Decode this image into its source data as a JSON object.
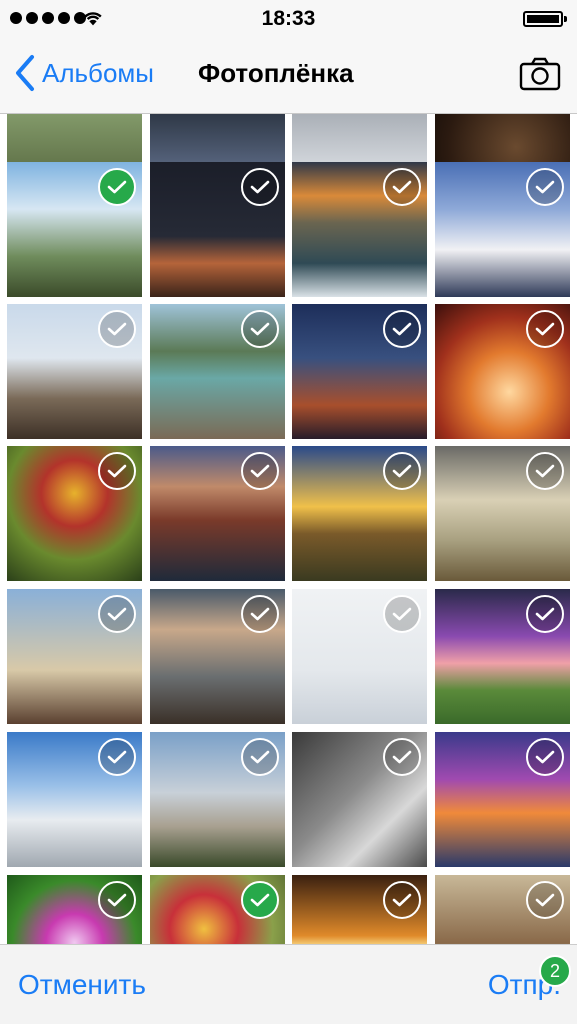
{
  "status": {
    "time": "18:33"
  },
  "nav": {
    "back_label": "Альбомы",
    "title": "Фотоплёнка"
  },
  "toolbar": {
    "cancel_label": "Отменить",
    "send_label": "Отпр.",
    "selected_count": "2"
  },
  "photos": [
    {
      "name": "photo-hills",
      "selected": null
    },
    {
      "name": "photo-lightning",
      "selected": null
    },
    {
      "name": "photo-clouds",
      "selected": null
    },
    {
      "name": "photo-rock",
      "selected": null
    },
    {
      "name": "photo-ibex-mountains",
      "selected": true
    },
    {
      "name": "photo-night-rock",
      "selected": false
    },
    {
      "name": "photo-sea-cliffs",
      "selected": false
    },
    {
      "name": "photo-santorini",
      "selected": false
    },
    {
      "name": "photo-lake-driftwood",
      "selected": false
    },
    {
      "name": "photo-forest-lake",
      "selected": false
    },
    {
      "name": "photo-tokyo-tower",
      "selected": false
    },
    {
      "name": "photo-antelope-canyon",
      "selected": false
    },
    {
      "name": "photo-tulips",
      "selected": false
    },
    {
      "name": "photo-cinque-terre",
      "selected": false
    },
    {
      "name": "photo-sunset-fence",
      "selected": false
    },
    {
      "name": "photo-savanna",
      "selected": false
    },
    {
      "name": "photo-eiffel-tower",
      "selected": false
    },
    {
      "name": "photo-pier",
      "selected": false
    },
    {
      "name": "photo-snow-tree",
      "selected": false
    },
    {
      "name": "photo-purple-hill",
      "selected": false
    },
    {
      "name": "photo-snow-mountains",
      "selected": false
    },
    {
      "name": "photo-castle",
      "selected": false
    },
    {
      "name": "photo-wave-sand",
      "selected": false
    },
    {
      "name": "photo-lake-sunset",
      "selected": false
    },
    {
      "name": "photo-pink-flower",
      "selected": false
    },
    {
      "name": "photo-tulip-close",
      "selected": true
    },
    {
      "name": "photo-sunset-rays",
      "selected": false
    },
    {
      "name": "photo-squirrel",
      "selected": false
    }
  ]
}
